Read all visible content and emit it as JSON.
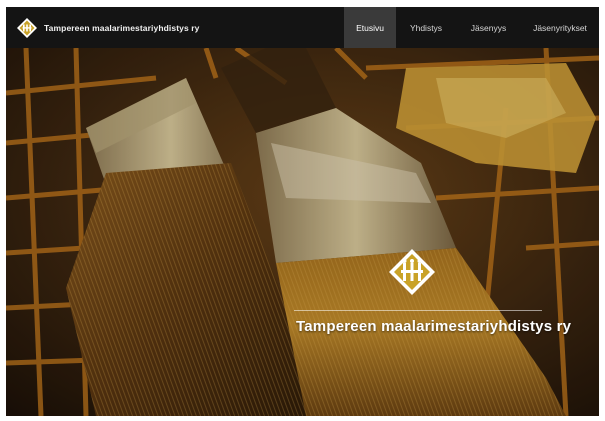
{
  "header": {
    "brand_name": "Tampereen maalarimestariyhdistys ry",
    "logo_icon": "association-emblem-icon"
  },
  "nav": {
    "items": [
      {
        "label": "Etusivu",
        "active": true
      },
      {
        "label": "Yhdistys",
        "active": false
      },
      {
        "label": "Jäsenyys",
        "active": false
      },
      {
        "label": "Jäsenyritykset",
        "active": false
      }
    ]
  },
  "hero": {
    "title": "Tampereen maalarimestariyhdistys ry",
    "emblem_icon": "association-emblem-icon",
    "image": "paint-brushes-photo"
  },
  "colors": {
    "nav_background": "#141414",
    "active_tab": "#3a3a3a",
    "emblem_gold": "#c9a227",
    "emblem_white": "#ffffff"
  }
}
